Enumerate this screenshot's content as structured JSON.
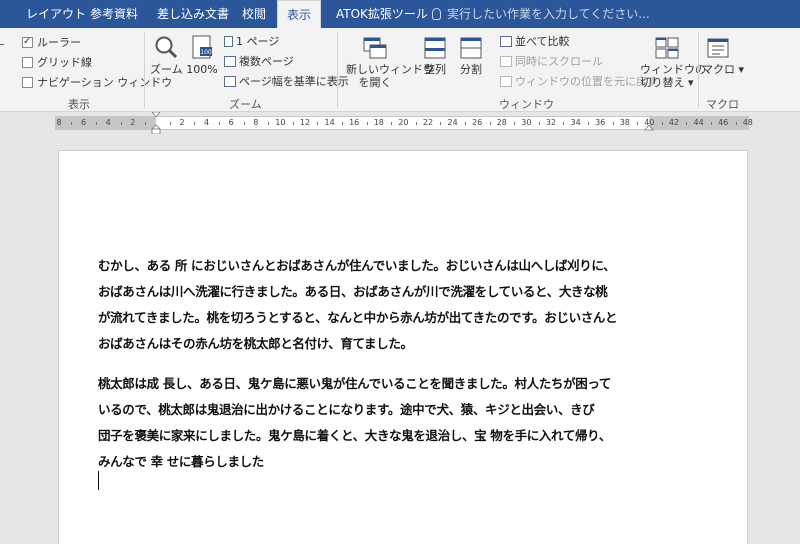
{
  "tabs": [
    {
      "label": "レイアウト",
      "active": false
    },
    {
      "label": "参考資料",
      "active": false
    },
    {
      "label": "差し込み文書",
      "active": false
    },
    {
      "label": "校閲",
      "active": false
    },
    {
      "label": "表示",
      "active": true
    },
    {
      "label": "ATOK拡張ツール",
      "active": false
    }
  ],
  "tell_me": "実行したい作業を入力してください...",
  "ribbon": {
    "show_group": {
      "label": "表示",
      "ruler": {
        "label": "ルーラー",
        "checked": true
      },
      "gridlines": {
        "label": "グリッド線",
        "checked": false
      },
      "nav_pane": {
        "label": "ナビゲーション ウィンドウ",
        "checked": false
      }
    },
    "zoom_group": {
      "label": "ズーム",
      "zoom": "ズーム",
      "hundred": "100%",
      "one_page": "1 ページ",
      "multi_page": "複数ページ",
      "page_width": "ページ幅を基準に表示"
    },
    "window_group": {
      "label": "ウィンドウ",
      "new_window_1": "新しいウィンドウ",
      "new_window_2": "を開く",
      "arrange": "整列",
      "split": "分割",
      "side_by_side": "並べて比較",
      "sync_scroll": "同時にスクロール",
      "reset_pos": "ウィンドウの位置を元に戻す",
      "switch_1": "ウィンドウの",
      "switch_2": "切り替え ▾"
    },
    "macro_group": {
      "label": "マクロ",
      "macro": "マクロ ▾"
    }
  },
  "ruler_labels": [
    "8",
    "6",
    "4",
    "2",
    "",
    "2",
    "4",
    "6",
    "8",
    "10",
    "12",
    "14",
    "16",
    "18",
    "20",
    "22",
    "24",
    "26",
    "28",
    "30",
    "32",
    "34",
    "36",
    "38",
    "40",
    "42",
    "44",
    "46",
    "48"
  ],
  "document": {
    "paragraphs": [
      {
        "lines": [
          "むかし、ある 所 におじいさんとおばあさんが住んでいました。おじいさんは山へしば刈りに、",
          "おばあさんは川へ洗濯に行きました。ある日、おばあさんが川で洗濯をしていると、大きな桃",
          "が流れてきました。桃を切ろうとすると、なんと中から赤ん坊が出てきたのです。おじいさんと",
          "おばあさんはその赤ん坊を桃太郎と名付け、育てました。"
        ]
      },
      {
        "lines": [
          "桃太郎は成 長し、ある日、鬼ケ島に悪い鬼が住んでいることを聞きました。村人たちが困って",
          "いるので、桃太郎は鬼退治に出かけることになります。途中で犬、猿、キジと出会い、きび",
          "団子を褒美に家来にしました。鬼ケ島に着くと、大きな鬼を退治し、宝 物を手に入れて帰り、",
          "みんなで 幸 せに暮らしました"
        ]
      }
    ]
  }
}
